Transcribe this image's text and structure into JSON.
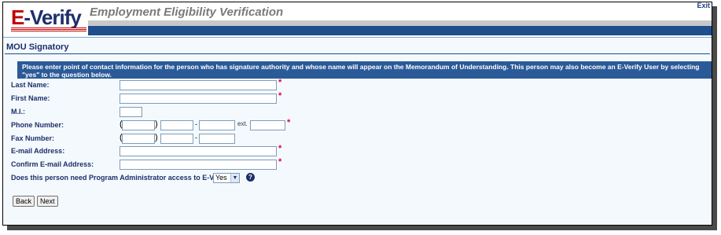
{
  "header": {
    "logo_text_e": "E",
    "logo_text_rest": "-Verify",
    "tagline": "Employment Eligibility Verification",
    "exit_label": "Exit"
  },
  "section": {
    "title": "MOU Signatory"
  },
  "instructions": "Please enter point of contact information for the person who has signature authority and whose name will appear on the Memorandum of Understanding. This person may also become an E-Verify User by selecting \"yes\" to the question below.",
  "form": {
    "last_name_label": "Last Name:",
    "first_name_label": "First Name:",
    "mi_label": "M.I.:",
    "phone_label": "Phone Number:",
    "phone_ext_label": "ext.",
    "fax_label": "Fax Number:",
    "email_label": "E-mail Address:",
    "confirm_email_label": "Confirm E-mail Address:",
    "pa_question": "Does this person need Program Administrator access to E-Verify?",
    "pa_selected": "Yes",
    "required_mark": "*",
    "dash": "-",
    "paren_open": "(",
    "paren_close": ")",
    "help_glyph": "?"
  },
  "buttons": {
    "back": "Back",
    "next": "Next"
  },
  "colors": {
    "brand_navy": "#1c2f6b",
    "brand_red": "#c00000",
    "band_blue": "#1f4e8c",
    "required_red": "#e0003a"
  }
}
